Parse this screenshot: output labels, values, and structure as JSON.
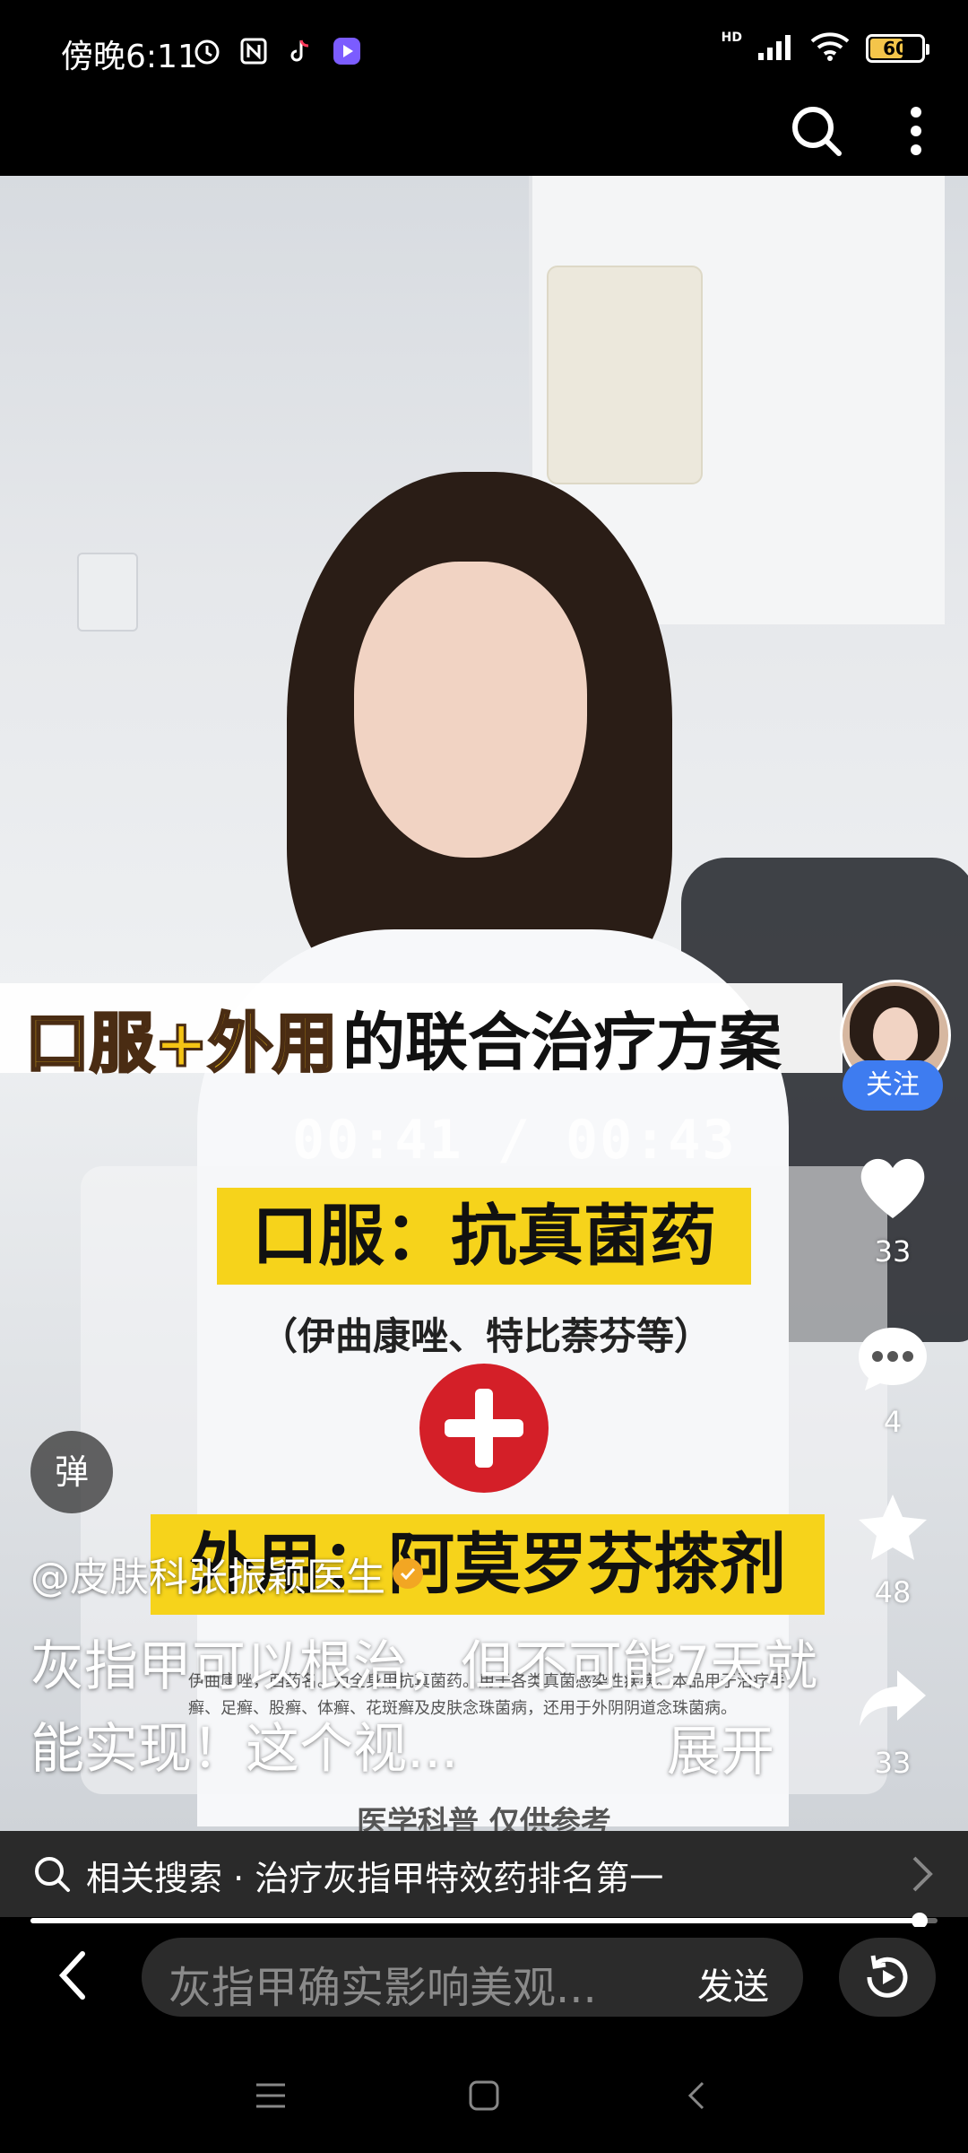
{
  "status_bar": {
    "time": "傍晚6:11",
    "network_label": "HD",
    "battery_text": "60"
  },
  "video": {
    "banner_highlight": "口服+外用",
    "banner_rest": "的联合治疗方案",
    "timecode": "00:41 / 00:43",
    "oral_label": "口服：抗真菌药",
    "oral_note": "（伊曲康唑、特比萘芬等）",
    "topical_label": "外用：阿莫罗芬搽剂",
    "fine_print": "伊曲康唑，西药名。为全身用抗真菌药。用于各类真菌感染性疾病。本品用于治疗手癣、足癣、股癣、体癣、花斑癣及皮肤念珠菌病，还用于外阴阴道念珠菌病。",
    "watermark_note": "医学科普 仅供参考"
  },
  "actions": {
    "follow_label": "关注",
    "like_count": "33",
    "comment_count": "4",
    "favorite_count": "48",
    "share_count": "33"
  },
  "danmu_label": "弹",
  "author": "@皮肤科张振颖医生",
  "description": "灰指甲可以根治，但不可能7天就能实现！这个视...",
  "expand_label": "展开",
  "related_search": "相关搜索 · 治疗灰指甲特效药排名第一",
  "progress": {
    "fraction": 0.98
  },
  "comment_input": {
    "placeholder": "灰指甲确实影响美观...",
    "send_label": "发送"
  }
}
